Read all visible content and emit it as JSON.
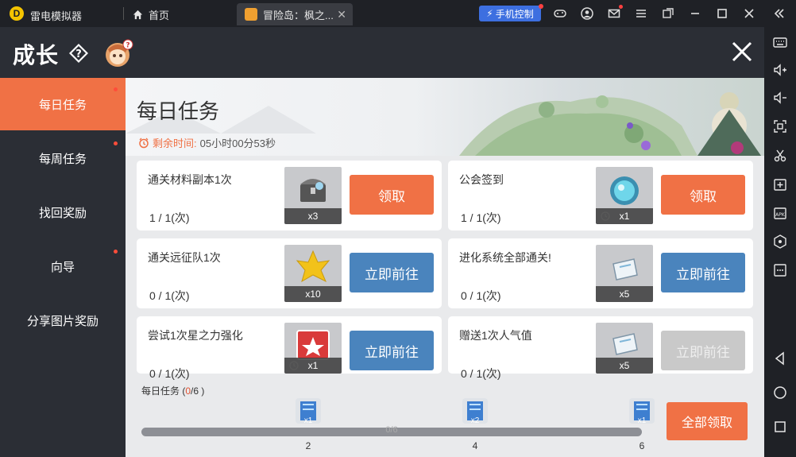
{
  "emulator": {
    "app_name": "雷电模拟器",
    "home_label": "首页",
    "tab_title": "冒险岛：枫之...",
    "phone_control_label": "手机控制"
  },
  "game": {
    "title": "成长",
    "menu": [
      {
        "label": "每日任务",
        "active": true,
        "dot": true
      },
      {
        "label": "每周任务",
        "active": false,
        "dot": true
      },
      {
        "label": "找回奖励",
        "active": false,
        "dot": false
      },
      {
        "label": "向导",
        "active": false,
        "dot": true
      },
      {
        "label": "分享图片奖励",
        "active": false,
        "dot": false
      }
    ],
    "banner": {
      "title": "每日任务",
      "timer_label": "剩余时间:",
      "timer_value": "05小时00分53秒"
    },
    "tasks": [
      {
        "name": "通关材料副本1次",
        "progress": "1 / 1(次)",
        "reward_qty": "x3",
        "timed": false,
        "button": "领取",
        "button_style": "orange"
      },
      {
        "name": "公会签到",
        "progress": "1 / 1(次)",
        "reward_qty": "x1",
        "timed": true,
        "button": "领取",
        "button_style": "orange"
      },
      {
        "name": "通关远征队1次",
        "progress": "0 / 1(次)",
        "reward_qty": "x10",
        "timed": false,
        "button": "立即前往",
        "button_style": "blue"
      },
      {
        "name": "进化系统全部通关!",
        "progress": "0 / 1(次)",
        "reward_qty": "x5",
        "timed": false,
        "button": "立即前往",
        "button_style": "blue"
      },
      {
        "name": "尝试1次星之力强化",
        "progress": "0 / 1(次)",
        "reward_qty": "x1",
        "timed": true,
        "button": "立即前往",
        "button_style": "blue"
      },
      {
        "name": "赠送1次人气值",
        "progress": "0 / 1(次)",
        "reward_qty": "x5",
        "timed": false,
        "button": "立即前往",
        "button_style": "gray"
      }
    ],
    "footer": {
      "label_prefix": "每日任务 (",
      "done": "0",
      "label_suffix": "/6 )",
      "progress_text": "0/6",
      "progress_fraction": 0,
      "milestones": [
        {
          "value": "2",
          "reward": "x1"
        },
        {
          "value": "4",
          "reward": "x2"
        },
        {
          "value": "6",
          "reward": "x1"
        }
      ],
      "claim_all_label": "全部领取"
    }
  },
  "colors": {
    "accent": "#f07145",
    "blue_button": "#4a84bd",
    "disabled_button": "#c9c9c9",
    "dark_bg": "#2b2e35"
  }
}
